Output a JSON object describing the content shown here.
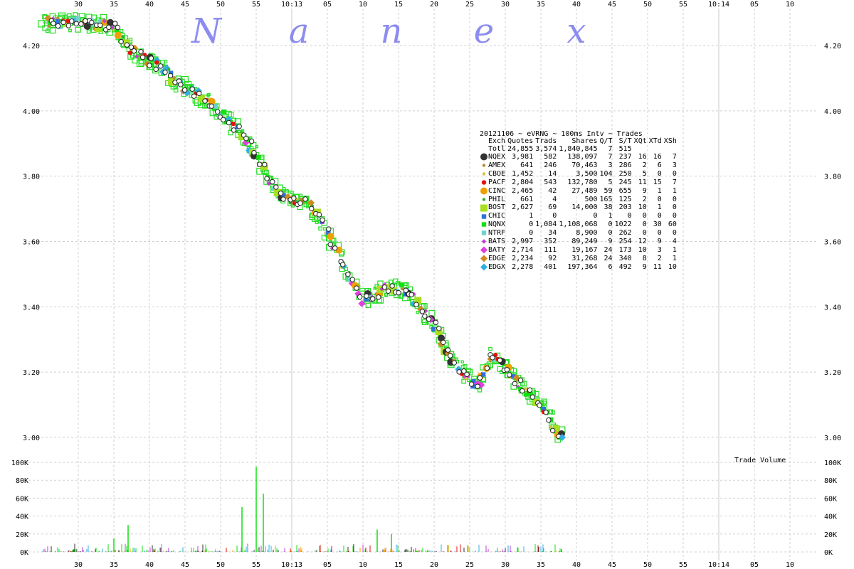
{
  "watermark": [
    "N",
    "a",
    "n",
    "e",
    "x"
  ],
  "chart_data": {
    "type": "scatter",
    "title": "20121106 ~ eVRNG ~ 100ms Intv ~ Trades",
    "x_tick_labels": [
      "30",
      "35",
      "40",
      "45",
      "50",
      "55",
      "10:13",
      "05",
      "10",
      "15",
      "20",
      "25",
      "30",
      "35",
      "40",
      "45",
      "50",
      "55",
      "10:14",
      "05",
      "10"
    ],
    "price_axis": {
      "ticks": [
        "4.20",
        "4.00",
        "3.80",
        "3.60",
        "3.40",
        "3.20",
        "3.00"
      ],
      "ylim": [
        3.0,
        4.2
      ]
    },
    "volume_axis": {
      "label": "Trade Volume",
      "ticks": [
        "100K",
        "80K",
        "60K",
        "40K",
        "20K",
        "0K"
      ],
      "ylim": [
        0,
        100000
      ]
    },
    "grid": true,
    "x_units": "seconds since 10:12:25",
    "price_path": [
      [
        0,
        4.27
      ],
      [
        5,
        4.27
      ],
      [
        10,
        4.26
      ],
      [
        12,
        4.2
      ],
      [
        14,
        4.16
      ],
      [
        17,
        4.13
      ],
      [
        19,
        4.08
      ],
      [
        21,
        4.06
      ],
      [
        23,
        4.03
      ],
      [
        25,
        3.99
      ],
      [
        27,
        3.95
      ],
      [
        29,
        3.9
      ],
      [
        31,
        3.83
      ],
      [
        33,
        3.75
      ],
      [
        35,
        3.73
      ],
      [
        37,
        3.72
      ],
      [
        39,
        3.67
      ],
      [
        41,
        3.58
      ],
      [
        43,
        3.5
      ],
      [
        45,
        3.42
      ],
      [
        47,
        3.44
      ],
      [
        49,
        3.46
      ],
      [
        51,
        3.45
      ],
      [
        53,
        3.4
      ],
      [
        55,
        3.35
      ],
      [
        57,
        3.25
      ],
      [
        59,
        3.2
      ],
      [
        61,
        3.15
      ],
      [
        63,
        3.25
      ],
      [
        65,
        3.21
      ],
      [
        67,
        3.16
      ],
      [
        69,
        3.12
      ],
      [
        71,
        3.08
      ],
      [
        72,
        3.02
      ],
      [
        73,
        3.0
      ]
    ],
    "volume_spikes": [
      [
        10,
        15000
      ],
      [
        12,
        30000
      ],
      [
        28,
        50000
      ],
      [
        30,
        95000
      ],
      [
        31,
        65000
      ],
      [
        47,
        25000
      ],
      [
        49,
        20000
      ]
    ],
    "legend": {
      "columns": [
        "Exch",
        "Quotes",
        "Trads",
        "Shares",
        "Q/T",
        "S/T",
        "XQt",
        "XTd",
        "XSh"
      ],
      "total": [
        "Totl",
        "24,855",
        "3,574",
        "1,840,845",
        "7",
        "515",
        "",
        "",
        ""
      ],
      "rows": [
        {
          "exch": "NQEX",
          "quotes": "3,981",
          "trads": "582",
          "shares": "138,097",
          "qt": "7",
          "st": "237",
          "xqt": "16",
          "xtd": "16",
          "xsh": "7",
          "color": "#333333",
          "shape": "circle-big"
        },
        {
          "exch": "AMEX",
          "quotes": "641",
          "trads": "246",
          "shares": "70,463",
          "qt": "3",
          "st": "286",
          "xqt": "2",
          "xtd": "6",
          "xsh": "3",
          "color": "#c08a3a",
          "shape": "dot"
        },
        {
          "exch": "CBOE",
          "quotes": "1,452",
          "trads": "14",
          "shares": "3,500",
          "qt": "104",
          "st": "250",
          "xqt": "5",
          "xtd": "0",
          "xsh": "0",
          "color": "#d8c040",
          "shape": "dot"
        },
        {
          "exch": "PACF",
          "quotes": "2,804",
          "trads": "543",
          "shares": "132,780",
          "qt": "5",
          "st": "245",
          "xqt": "11",
          "xtd": "15",
          "xsh": "7",
          "color": "#e81010",
          "shape": "circle"
        },
        {
          "exch": "CINC",
          "quotes": "2,465",
          "trads": "42",
          "shares": "27,489",
          "qt": "59",
          "st": "655",
          "xqt": "9",
          "xtd": "1",
          "xsh": "1",
          "color": "#f0a000",
          "shape": "circle-big"
        },
        {
          "exch": "PHIL",
          "quotes": "661",
          "trads": "4",
          "shares": "500",
          "qt": "165",
          "st": "125",
          "xqt": "2",
          "xtd": "0",
          "xsh": "0",
          "color": "#30b030",
          "shape": "dot"
        },
        {
          "exch": "BOST",
          "quotes": "2,627",
          "trads": "69",
          "shares": "14,000",
          "qt": "38",
          "st": "203",
          "xqt": "10",
          "xtd": "1",
          "xsh": "0",
          "color": "#a8e020",
          "shape": "square-big"
        },
        {
          "exch": "CHIC",
          "quotes": "1",
          "trads": "0",
          "shares": "0",
          "qt": "1",
          "st": "0",
          "xqt": "0",
          "xtd": "0",
          "xsh": "0",
          "color": "#3070e0",
          "shape": "square"
        },
        {
          "exch": "NQNX",
          "quotes": "0",
          "trads": "1,084",
          "shares": "1,108,068",
          "qt": "0",
          "st": "1022",
          "xqt": "0",
          "xtd": "30",
          "xsh": "60",
          "color": "#10e010",
          "shape": "square"
        },
        {
          "exch": "NTRF",
          "quotes": "0",
          "trads": "34",
          "shares": "8,900",
          "qt": "0",
          "st": "262",
          "xqt": "0",
          "xtd": "0",
          "xsh": "0",
          "color": "#70d0d0",
          "shape": "square"
        },
        {
          "exch": "BATS",
          "quotes": "2,997",
          "trads": "352",
          "shares": "89,249",
          "qt": "9",
          "st": "254",
          "xqt": "12",
          "xtd": "9",
          "xsh": "4",
          "color": "#c040d0",
          "shape": "diamond"
        },
        {
          "exch": "BATY",
          "quotes": "2,714",
          "trads": "111",
          "shares": "19,167",
          "qt": "24",
          "st": "173",
          "xqt": "10",
          "xtd": "3",
          "xsh": "1",
          "color": "#e040e0",
          "shape": "diamond-big"
        },
        {
          "exch": "EDGE",
          "quotes": "2,234",
          "trads": "92",
          "shares": "31,268",
          "qt": "24",
          "st": "340",
          "xqt": "8",
          "xtd": "2",
          "xsh": "1",
          "color": "#d08a20",
          "shape": "diamond-big"
        },
        {
          "exch": "EDGX",
          "quotes": "2,278",
          "trads": "401",
          "shares": "197,364",
          "qt": "6",
          "st": "492",
          "xqt": "9",
          "xtd": "11",
          "xsh": "10",
          "color": "#30b0e0",
          "shape": "diamond-big"
        }
      ]
    }
  }
}
